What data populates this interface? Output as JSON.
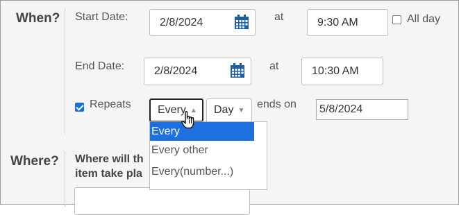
{
  "when": {
    "section_label": "When?",
    "start_label": "Start Date:",
    "start_date": "2/8/2024",
    "at_label": "at",
    "start_time": "9:30 AM",
    "all_day_label": "All day",
    "all_day_checked": false,
    "end_label": "End Date:",
    "end_date": "2/8/2024",
    "end_time": "10:30 AM",
    "repeats_label": "Repeats",
    "repeats_checked": true,
    "frequency_value": "Every",
    "frequency_options": [
      "Every",
      "Every other",
      "Every(number...)"
    ],
    "unit_value": "Day",
    "ends_on_label": "ends on",
    "ends_on_date": "5/8/2024"
  },
  "where": {
    "section_label": "Where?",
    "question_line1": "Where will th",
    "question_line2": "item take pla"
  },
  "colors": {
    "highlight": "#1e6fe0",
    "calendar_icon": "#1f5e9e"
  }
}
